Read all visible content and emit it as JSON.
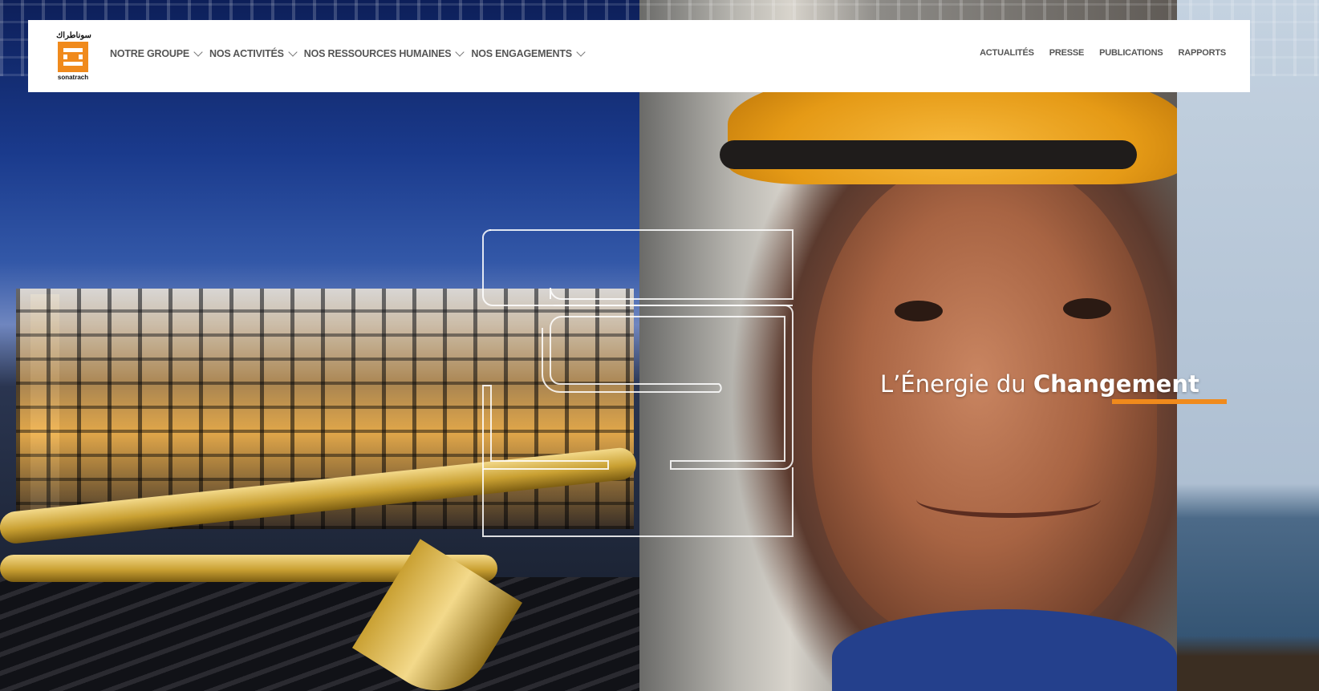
{
  "brand": {
    "name": "sonatrach",
    "arabic_name": "سوناطراك",
    "accent_color": "#f08a1c"
  },
  "nav_main": [
    {
      "label": "NOTRE GROUPE",
      "icon": "chevron-down-icon"
    },
    {
      "label": "NOS ACTIVITÉS",
      "icon": "chevron-down-icon"
    },
    {
      "label": "NOS RESSOURCES HUMAINES",
      "icon": "chevron-down-icon"
    },
    {
      "label": "NOS ENGAGEMENTS",
      "icon": "chevron-down-icon"
    }
  ],
  "nav_secondary": [
    {
      "label": "ACTUALITÉS"
    },
    {
      "label": "PRESSE"
    },
    {
      "label": "PUBLICATIONS"
    },
    {
      "label": "RAPPORTS"
    }
  ],
  "hero": {
    "tagline_light": "L’Énergie du ",
    "tagline_bold": "Changement"
  }
}
